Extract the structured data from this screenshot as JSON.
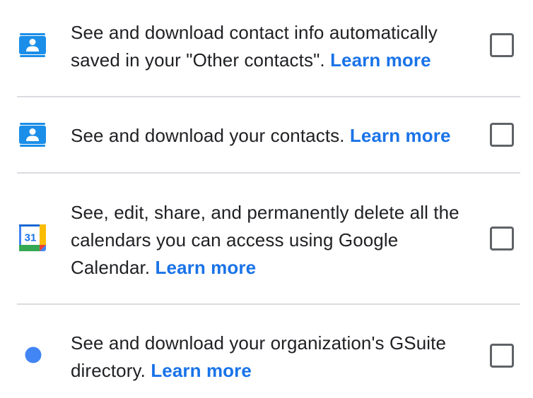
{
  "scopes": [
    {
      "text": "See and download contact info automatically saved in your \"Other contacts\".",
      "link": "Learn more",
      "icon": "contacts-icon",
      "checked": false
    },
    {
      "text": "See and download your contacts.",
      "link": "Learn more",
      "icon": "contacts-icon",
      "checked": false
    },
    {
      "text": "See, edit, share, and permanently delete all the calendars you can access using Google Calendar.",
      "link": "Learn more",
      "icon": "google-calendar-icon",
      "icon_text": "31",
      "checked": false
    },
    {
      "text": "See and download your organization's GSuite directory.",
      "link": "Learn more",
      "icon": "blue-dot-icon",
      "checked": false
    }
  ],
  "colors": {
    "link": "#1a73e8",
    "contacts_icon": "#1a8ee8",
    "divider": "#dadce0",
    "checkbox_border": "#5f6368",
    "dot": "#4285f4"
  }
}
